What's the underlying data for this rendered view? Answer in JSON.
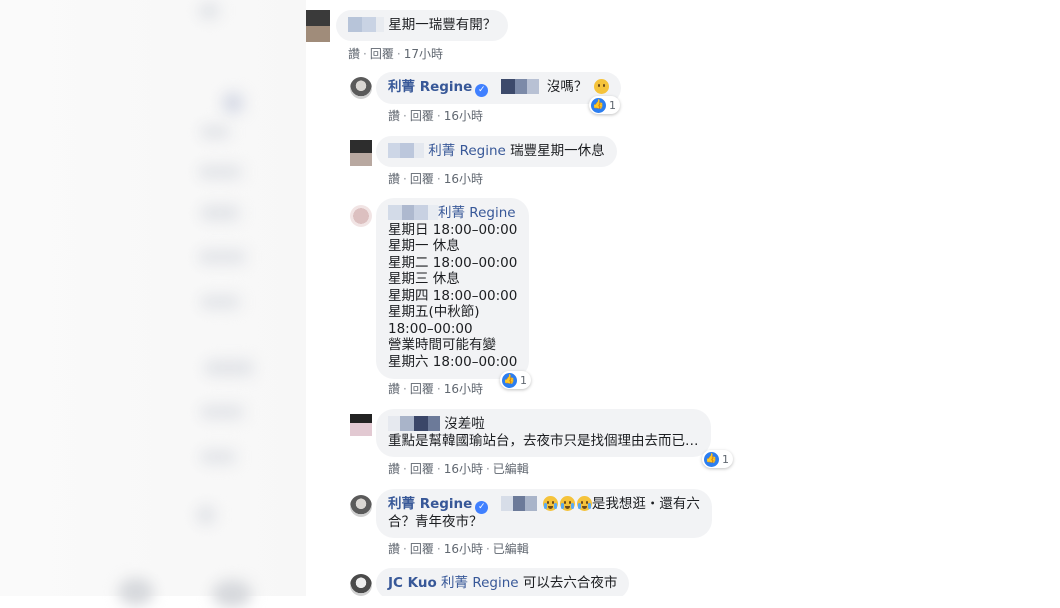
{
  "comments": [
    {
      "text": "星期一瑞豐有開？",
      "actions": {
        "like": "讚",
        "reply": "回覆",
        "time": "17小時"
      }
    },
    {
      "author": "利菁 Regine",
      "text": "沒嗎？",
      "reaction_count": "1",
      "actions": {
        "like": "讚",
        "reply": "回覆",
        "time": "16小時"
      }
    },
    {
      "tag": "利菁 Regine",
      "text": "瑞豐星期一休息",
      "actions": {
        "like": "讚",
        "reply": "回覆",
        "time": "16小時"
      }
    },
    {
      "tag": "利菁 Regine",
      "lines": [
        "星期日 18:00–00:00",
        "星期一 休息",
        "星期二 18:00–00:00",
        "星期三 休息",
        "星期四 18:00–00:00",
        "星期五(中秋節)",
        "18:00–00:00",
        "營業時間可能有變",
        "星期六 18:00–00:00"
      ],
      "reaction_count": "1",
      "actions": {
        "like": "讚",
        "reply": "回覆",
        "time": "16小時"
      }
    },
    {
      "line1": "沒差啦",
      "line2": "重點是幫韓國瑜站台，去夜市只是找個理由去而已…",
      "reaction_count": "1",
      "actions": {
        "like": "讚",
        "reply": "回覆",
        "time": "16小時",
        "edited": "已編輯"
      }
    },
    {
      "author": "利菁 Regine",
      "line1": "是我想逛・還有六",
      "line2": "合？青年夜市？",
      "actions": {
        "like": "讚",
        "reply": "回覆",
        "time": "16小時",
        "edited": "已編輯"
      }
    },
    {
      "author": "JC Kuo",
      "tag": "利菁 Regine",
      "text": "可以去六合夜市"
    }
  ],
  "colors": {
    "link": "#385898",
    "bubble": "#f2f3f5",
    "meta": "#606770",
    "like_blue": "#2c7ef0"
  },
  "icons": [
    "verified-badge-icon",
    "like-reaction-icon",
    "sad-emoji-icon",
    "crying-emoji-icon"
  ]
}
